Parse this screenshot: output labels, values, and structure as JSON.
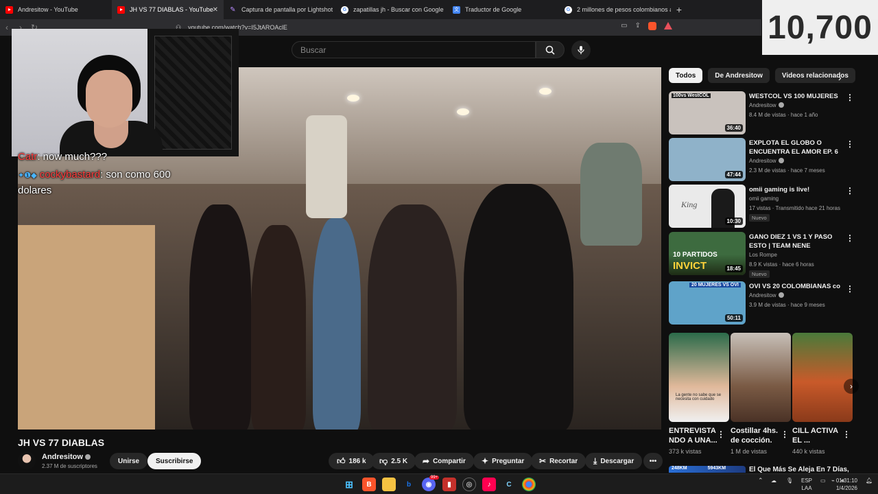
{
  "browser": {
    "tabs": [
      {
        "title": "Andresitow - YouTube",
        "icon": "youtube-icon",
        "active": false
      },
      {
        "title": "JH VS 77 DIABLAS - YouTube",
        "icon": "youtube-icon",
        "active": true
      },
      {
        "title": "Captura de pantalla por Lightshot",
        "icon": "lightshot-icon",
        "active": false
      },
      {
        "title": "zapatillas jh - Buscar con Google",
        "icon": "google-icon",
        "active": false
      },
      {
        "title": "Traductor de Google",
        "icon": "translate-icon",
        "active": false
      },
      {
        "title": "2 millones de pesos colombianos a p",
        "icon": "google-icon",
        "active": false
      }
    ],
    "url": "youtube.com/watch?v=I5JtAROAclE"
  },
  "overlay": {
    "score": "10,700",
    "chat": [
      {
        "user": "Catr",
        "message": ": now much???"
      },
      {
        "user": "cockybastard",
        "message": ": son como 600 dolares"
      }
    ]
  },
  "search": {
    "placeholder": "Buscar"
  },
  "video": {
    "title": "JH VS 77 DIABLAS",
    "channel": "Andresitow",
    "subscribers": "2.37 M de suscriptores",
    "join_label": "Unirse",
    "subscribe_label": "Suscribirse",
    "likes": "186 k",
    "dislikes": "2.5 K",
    "share_label": "Compartir",
    "ask_label": "Preguntar",
    "clip_label": "Recortar",
    "download_label": "Descargar"
  },
  "sidebar": {
    "chips": [
      "Todos",
      "De Andresitow",
      "Videos relacionados"
    ],
    "videos": [
      {
        "title": "WESTCOL VS 100 MUJERES",
        "channel": "Andresitow",
        "verified": true,
        "meta": "8.4 M de vistas · hace 1 año",
        "duration": "36:40",
        "badge": "",
        "thumb_color": "#c9c2bd"
      },
      {
        "title": "EXPLOTA EL GLOBO O ENCUENTRA EL AMOR EP. 6",
        "channel": "Andresitow",
        "verified": true,
        "meta": "2.3 M de vistas · hace 7 meses",
        "duration": "47:44",
        "badge": "",
        "thumb_color": "#8fb2c9"
      },
      {
        "title": "omii gaming  is live!",
        "channel": "omii gaming",
        "verified": false,
        "meta": "17 vistas · Transmitido hace 21 horas",
        "duration": "10:30",
        "badge": "Nuevo",
        "thumb_color": "#eaeaea"
      },
      {
        "title": "GANO DIEZ 1 VS 1 Y PASO ESTO | TEAM NENE",
        "channel": "Los Rompe",
        "verified": false,
        "meta": "8.9 K vistas · hace 6 horas",
        "duration": "18:45",
        "badge": "Nuevo",
        "thumb_color": "#3d6b3f"
      },
      {
        "title": "OVI VS 20 COLOMBIANAS co",
        "channel": "Andresitow",
        "verified": true,
        "meta": "3.9 M de vistas · hace 9 meses",
        "duration": "50:11",
        "badge": "",
        "thumb_color": "#5fa3c9"
      }
    ],
    "shorts": [
      {
        "title": "ENTREVISTA NDO A UNA...",
        "views": "373 k vistas",
        "thumb_color": "#2b6b4a"
      },
      {
        "title": "Costillar 4hs. de cocción.",
        "views": "1 M de vistas",
        "thumb_color": "#7a5a44"
      },
      {
        "title": "CILL ACTIVA EL ...",
        "views": "440 k vistas",
        "thumb_color": "#c95a2a"
      }
    ],
    "next_title": "El Que Más Se Aleja En 7 Días,",
    "next_thumb_labels": [
      "248KM",
      "5943KM"
    ]
  },
  "taskbar": {
    "lang": "ESP",
    "lang2": "LAA",
    "time": "01:31:10",
    "date": "1/4/2026",
    "notification_count": "99+"
  }
}
